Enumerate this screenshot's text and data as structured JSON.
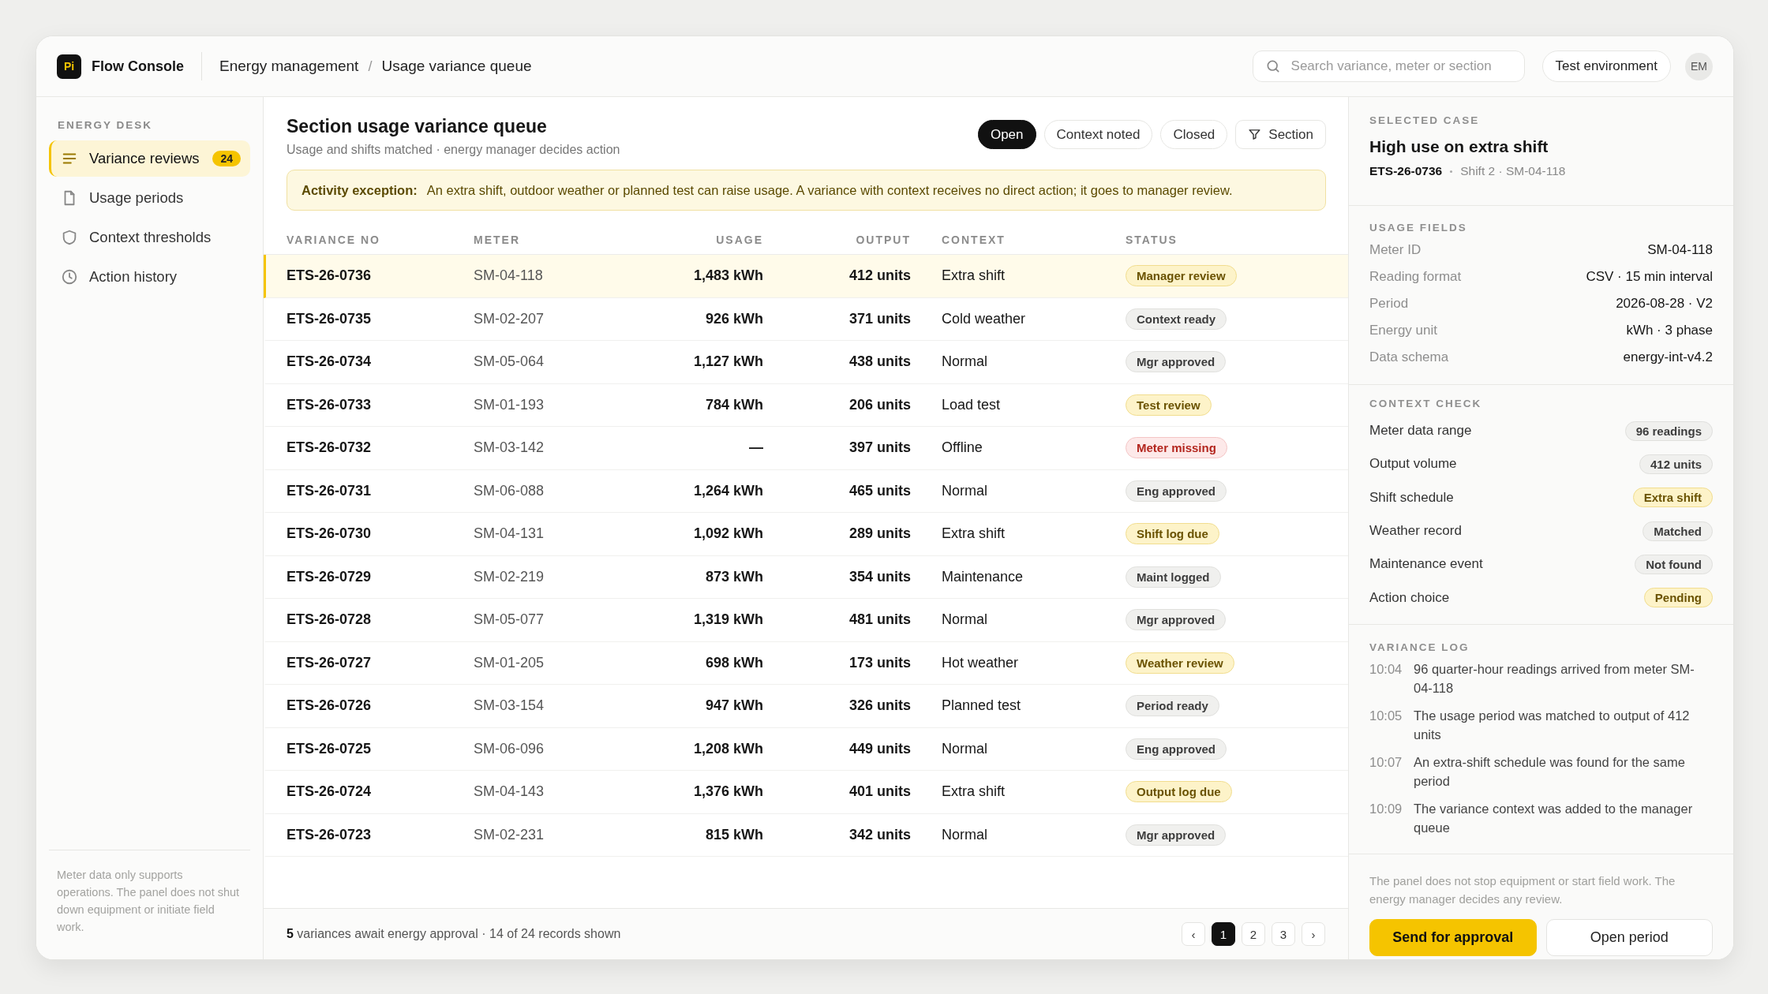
{
  "header": {
    "logo": "Pi",
    "app_name": "Flow Console",
    "breadcrumb": [
      "Energy management",
      "Usage variance queue"
    ],
    "breadcrumb_separator": "/",
    "search": {
      "placeholder": "Search variance, meter or section"
    },
    "environment": "Test environment",
    "avatar": "EM"
  },
  "sidebar": {
    "heading": "ENERGY DESK",
    "items": [
      {
        "label": "Variance reviews",
        "badge": "24",
        "selected": true
      },
      {
        "label": "Usage periods",
        "selected": false
      },
      {
        "label": "Context thresholds",
        "selected": false
      },
      {
        "label": "Action history",
        "selected": false
      }
    ],
    "note": "Meter data only supports operations. The panel does not shut down equipment or initiate field work."
  },
  "queue": {
    "title": "Section usage variance queue",
    "subtitle": "Usage and shifts matched · energy manager decides action",
    "filters": [
      {
        "label": "Open",
        "selected": true
      },
      {
        "label": "Context noted",
        "selected": false
      },
      {
        "label": "Closed",
        "selected": false
      }
    ],
    "section_button": "Section",
    "alert": {
      "label": "Activity exception:",
      "text": "An extra shift, outdoor weather or planned test can raise usage. A variance with context receives no direct action; it goes to manager review."
    },
    "columns": [
      "VARIANCE NO",
      "METER",
      "USAGE",
      "OUTPUT",
      "CONTEXT",
      "STATUS"
    ],
    "rows": [
      {
        "id": "ETS-26-0736",
        "meter": "SM-04-118",
        "usage": "1,483 kWh",
        "output": "412 units",
        "context": "Extra shift",
        "status": "Manager review",
        "kind": "warning",
        "selected": true
      },
      {
        "id": "ETS-26-0735",
        "meter": "SM-02-207",
        "usage": "926 kWh",
        "output": "371 units",
        "context": "Cold weather",
        "status": "Context ready",
        "kind": "neutral",
        "selected": false
      },
      {
        "id": "ETS-26-0734",
        "meter": "SM-05-064",
        "usage": "1,127 kWh",
        "output": "438 units",
        "context": "Normal",
        "status": "Mgr approved",
        "kind": "neutral",
        "selected": false
      },
      {
        "id": "ETS-26-0733",
        "meter": "SM-01-193",
        "usage": "784 kWh",
        "output": "206 units",
        "context": "Load test",
        "status": "Test review",
        "kind": "warning",
        "selected": false
      },
      {
        "id": "ETS-26-0732",
        "meter": "SM-03-142",
        "usage": "—",
        "output": "397 units",
        "context": "Offline",
        "status": "Meter missing",
        "kind": "error",
        "selected": false
      },
      {
        "id": "ETS-26-0731",
        "meter": "SM-06-088",
        "usage": "1,264 kWh",
        "output": "465 units",
        "context": "Normal",
        "status": "Eng approved",
        "kind": "neutral",
        "selected": false
      },
      {
        "id": "ETS-26-0730",
        "meter": "SM-04-131",
        "usage": "1,092 kWh",
        "output": "289 units",
        "context": "Extra shift",
        "status": "Shift log due",
        "kind": "warning",
        "selected": false
      },
      {
        "id": "ETS-26-0729",
        "meter": "SM-02-219",
        "usage": "873 kWh",
        "output": "354 units",
        "context": "Maintenance",
        "status": "Maint logged",
        "kind": "neutral",
        "selected": false
      },
      {
        "id": "ETS-26-0728",
        "meter": "SM-05-077",
        "usage": "1,319 kWh",
        "output": "481 units",
        "context": "Normal",
        "status": "Mgr approved",
        "kind": "neutral",
        "selected": false
      },
      {
        "id": "ETS-26-0727",
        "meter": "SM-01-205",
        "usage": "698 kWh",
        "output": "173 units",
        "context": "Hot weather",
        "status": "Weather review",
        "kind": "warning",
        "selected": false
      },
      {
        "id": "ETS-26-0726",
        "meter": "SM-03-154",
        "usage": "947 kWh",
        "output": "326 units",
        "context": "Planned test",
        "status": "Period ready",
        "kind": "neutral",
        "selected": false
      },
      {
        "id": "ETS-26-0725",
        "meter": "SM-06-096",
        "usage": "1,208 kWh",
        "output": "449 units",
        "context": "Normal",
        "status": "Eng approved",
        "kind": "neutral",
        "selected": false
      },
      {
        "id": "ETS-26-0724",
        "meter": "SM-04-143",
        "usage": "1,376 kWh",
        "output": "401 units",
        "context": "Extra shift",
        "status": "Output log due",
        "kind": "warning",
        "selected": false
      },
      {
        "id": "ETS-26-0723",
        "meter": "SM-02-231",
        "usage": "815 kWh",
        "output": "342 units",
        "context": "Normal",
        "status": "Mgr approved",
        "kind": "neutral",
        "selected": false
      }
    ],
    "footer": "**5** variances await energy approval · 14 of 24 records shown",
    "pagination": {
      "prev": "‹",
      "next": "›",
      "pages": [
        {
          "label": "1",
          "selected": true
        },
        {
          "label": "2",
          "selected": false
        },
        {
          "label": "3",
          "selected": false
        }
      ]
    }
  },
  "detail": {
    "heading": "SELECTED CASE",
    "title": "High use on extra shift",
    "case_id": "ETS-26-0736",
    "case_meta": "Shift 2 · SM-04-118",
    "fields_heading": "USAGE FIELDS",
    "fields": [
      {
        "label": "Meter ID",
        "value": "SM-04-118"
      },
      {
        "label": "Reading format",
        "value": "CSV · 15 min interval"
      },
      {
        "label": "Period",
        "value": "2026-08-28 · V2"
      },
      {
        "label": "Energy unit",
        "value": "kWh · 3 phase"
      },
      {
        "label": "Data schema",
        "value": "energy-int-v4.2"
      }
    ],
    "checks_heading": "CONTEXT CHECK",
    "checks": [
      {
        "label": "Meter data range",
        "value": "96 readings",
        "kind": "neutral"
      },
      {
        "label": "Output volume",
        "value": "412 units",
        "kind": "neutral"
      },
      {
        "label": "Shift schedule",
        "value": "Extra shift",
        "kind": "warning"
      },
      {
        "label": "Weather record",
        "value": "Matched",
        "kind": "neutral"
      },
      {
        "label": "Maintenance event",
        "value": "Not found",
        "kind": "neutral"
      },
      {
        "label": "Action choice",
        "value": "Pending",
        "kind": "warning"
      }
    ],
    "log_heading": "VARIANCE LOG",
    "log": [
      {
        "time": "10:04",
        "text": "96 quarter-hour readings arrived from meter SM-04-118"
      },
      {
        "time": "10:05",
        "text": "The usage period was matched to output of 412 units"
      },
      {
        "time": "10:07",
        "text": "An extra-shift schedule was found for the same period"
      },
      {
        "time": "10:09",
        "text": "The variance context was added to the manager queue"
      }
    ],
    "note": "The panel does not stop equipment or start field work. The energy manager decides any review.",
    "primary_button": "Send for approval",
    "secondary_button": "Open period"
  }
}
